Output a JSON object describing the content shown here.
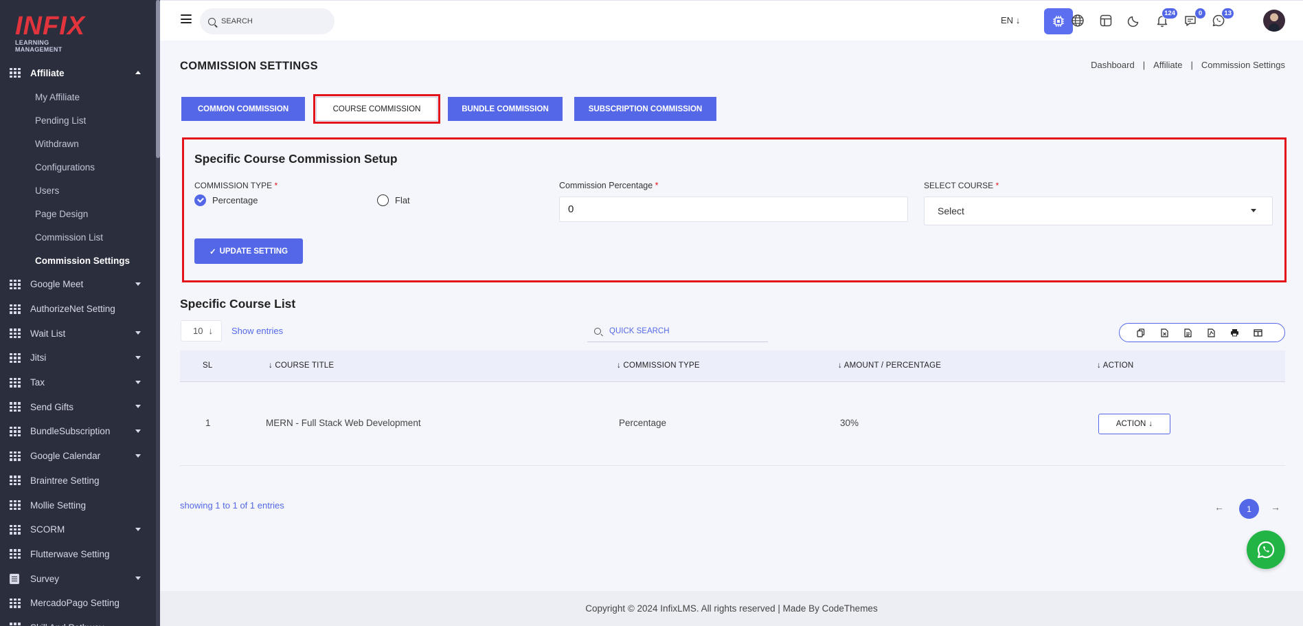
{
  "brand": {
    "logo_text": "INFIX",
    "logo_subtitle": "LEARNING MANAGEMENT"
  },
  "sidebar": {
    "affiliate": {
      "label": "Affiliate",
      "children": [
        "My Affiliate",
        "Pending List",
        "Withdrawn",
        "Configurations",
        "Users",
        "Page Design",
        "Commission List",
        "Commission Settings"
      ],
      "active_child": "Commission Settings"
    },
    "items": [
      {
        "label": "Google Meet",
        "icon": "grid-icon",
        "has_caret": true
      },
      {
        "label": "AuthorizeNet Setting",
        "icon": "grid-icon",
        "has_caret": false
      },
      {
        "label": "Wait List",
        "icon": "grid-icon",
        "has_caret": true
      },
      {
        "label": "Jitsi",
        "icon": "grid-icon",
        "has_caret": true
      },
      {
        "label": "Tax",
        "icon": "grid-icon",
        "has_caret": true
      },
      {
        "label": "Send Gifts",
        "icon": "grid-icon",
        "has_caret": true
      },
      {
        "label": "BundleSubscription",
        "icon": "grid-icon",
        "has_caret": true
      },
      {
        "label": "Google Calendar",
        "icon": "grid-icon",
        "has_caret": true
      },
      {
        "label": "Braintree Setting",
        "icon": "grid-icon",
        "has_caret": false
      },
      {
        "label": "Mollie Setting",
        "icon": "grid-icon",
        "has_caret": false
      },
      {
        "label": "SCORM",
        "icon": "grid-icon",
        "has_caret": true
      },
      {
        "label": "Flutterwave Setting",
        "icon": "grid-icon",
        "has_caret": false
      },
      {
        "label": "Survey",
        "icon": "document-icon",
        "has_caret": true
      },
      {
        "label": "MercadoPago Setting",
        "icon": "grid-icon",
        "has_caret": false
      },
      {
        "label": "Skill And Pathway",
        "icon": "grid-icon",
        "has_caret": false
      }
    ]
  },
  "topbar": {
    "search_placeholder": "SEARCH",
    "language": "EN",
    "notifications_count": "124",
    "messages_count": "0",
    "whatsapp_count": "13"
  },
  "page": {
    "title": "COMMISSION SETTINGS",
    "breadcrumb": [
      "Dashboard",
      "Affiliate",
      "Commission Settings"
    ],
    "breadcrumb_sep": "|"
  },
  "tabs": [
    "COMMON COMMISSION",
    "COURSE COMMISSION",
    "BUNDLE COMMISSION",
    "SUBSCRIPTION COMMISSION"
  ],
  "active_tab": "COURSE COMMISSION",
  "setup": {
    "title": "Specific Course Commission Setup",
    "commission_type_label": "COMMISSION TYPE",
    "required_mark": "*",
    "option_percentage": "Percentage",
    "option_flat": "Flat",
    "selected_option": "Percentage",
    "percentage_label": "Commission Percentage",
    "percentage_value": "0",
    "course_label": "SELECT COURSE",
    "course_value": "Select",
    "update_button": "UPDATE SETTING",
    "update_icon": "✓"
  },
  "list": {
    "title": "Specific Course List",
    "entries_value": "10",
    "show_entries": "Show entries",
    "quick_search_placeholder": "QUICK SEARCH",
    "export_icons": [
      "copy-icon",
      "excel-icon",
      "csv-icon",
      "pdf-icon",
      "print-icon",
      "columns-icon"
    ],
    "columns": [
      "SL",
      "COURSE TITLE",
      "COMMISSION TYPE",
      "AMOUNT / PERCENTAGE",
      "ACTION"
    ],
    "rows": [
      {
        "sl": "1",
        "course_title": "MERN - Full Stack Web Development",
        "commission_type": "Percentage",
        "amount": "30%",
        "action_label": "ACTION"
      }
    ],
    "showing_text": "showing 1 to 1 of 1 entries",
    "current_page": "1",
    "prev_glyph": "←",
    "next_glyph": "→"
  },
  "footer": {
    "text": "Copyright © 2024 InfixLMS. All rights reserved | Made By CodeThemes"
  },
  "colors": {
    "primary": "#5468e7",
    "highlight": "#e3131b",
    "sidebar_bg": "#2a2e3d",
    "whatsapp": "#22b545"
  }
}
